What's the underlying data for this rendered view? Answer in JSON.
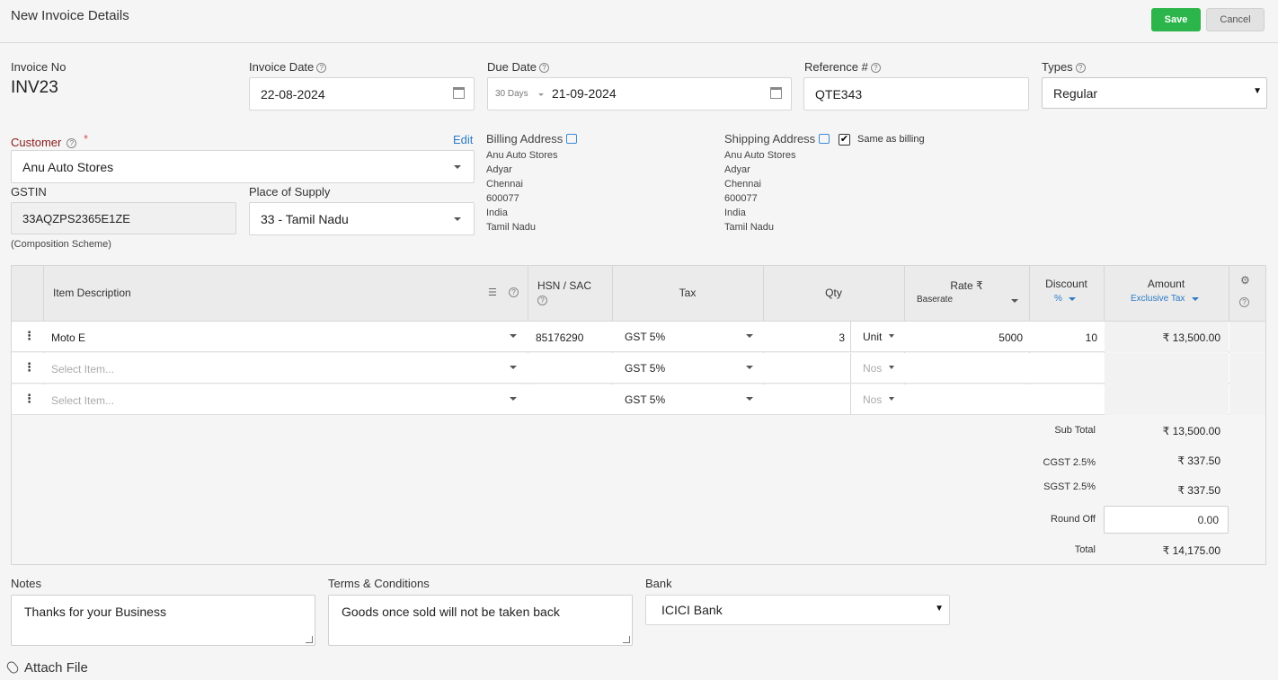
{
  "header": {
    "title": "New Invoice Details",
    "save_label": "Save",
    "cancel_label": "Cancel"
  },
  "invoice_no": {
    "label": "Invoice No",
    "value": "INV23"
  },
  "invoice_date": {
    "label": "Invoice Date",
    "value": "22-08-2024"
  },
  "due_date": {
    "label": "Due Date",
    "terms": "30 Days",
    "value": "21-09-2024"
  },
  "reference": {
    "label": "Reference #",
    "value": "QTE343"
  },
  "types": {
    "label": "Types",
    "value": "Regular"
  },
  "customer": {
    "label": "Customer",
    "required_mark": "*",
    "edit_label": "Edit",
    "value": "Anu Auto Stores"
  },
  "gstin": {
    "label": "GSTIN",
    "value": "33AQZPS2365E1ZE",
    "note": "(Composition Scheme)"
  },
  "place_of_supply": {
    "label": "Place of Supply",
    "value": "33 - Tamil Nadu"
  },
  "billing": {
    "label": "Billing Address",
    "lines": [
      "Anu Auto Stores",
      "Adyar",
      "Chennai",
      "600077",
      "India",
      "Tamil Nadu"
    ]
  },
  "shipping": {
    "label": "Shipping Address",
    "same_as_billing": "Same as billing",
    "checked": true,
    "lines": [
      "Anu Auto Stores",
      "Adyar",
      "Chennai",
      "600077",
      "India",
      "Tamil Nadu"
    ]
  },
  "table": {
    "headers": {
      "item": "Item Description",
      "hsn": "HSN / SAC",
      "tax": "Tax",
      "qty": "Qty",
      "rate": "Rate ₹",
      "rate_sub": "Baserate",
      "discount": "Discount",
      "discount_sub": "%",
      "amount": "Amount",
      "amount_sub": "Exclusive Tax"
    },
    "rows": [
      {
        "item": "Moto E",
        "hsn": "85176290",
        "tax": "GST 5%",
        "qty": "3",
        "unit": "Unit",
        "rate": "5000",
        "discount": "10",
        "amount": "₹ 13,500.00"
      },
      {
        "item": "Select Item...",
        "hsn": "",
        "tax": "GST 5%",
        "qty": "",
        "unit": "Nos",
        "rate": "",
        "discount": "",
        "amount": ""
      },
      {
        "item": "Select Item...",
        "hsn": "",
        "tax": "GST 5%",
        "qty": "",
        "unit": "Nos",
        "rate": "",
        "discount": "",
        "amount": ""
      }
    ]
  },
  "summary": {
    "sub_total_label": "Sub Total",
    "sub_total": "₹ 13,500.00",
    "cgst_label": "CGST 2.5%",
    "cgst": "₹ 337.50",
    "sgst_label": "SGST 2.5%",
    "sgst": "₹ 337.50",
    "round_off_label": "Round Off",
    "round_off": "0.00",
    "total_label": "Total",
    "total": "₹ 14,175.00"
  },
  "notes": {
    "label": "Notes",
    "value": "Thanks for your Business"
  },
  "terms": {
    "label": "Terms & Conditions",
    "value": "Goods once sold will not be taken back"
  },
  "bank": {
    "label": "Bank",
    "value": "ICICI Bank"
  },
  "attach": {
    "label": "Attach File"
  },
  "colors": {
    "save": "#2bb54a",
    "link": "#2c7bc4",
    "required": "#8b1a1a"
  }
}
